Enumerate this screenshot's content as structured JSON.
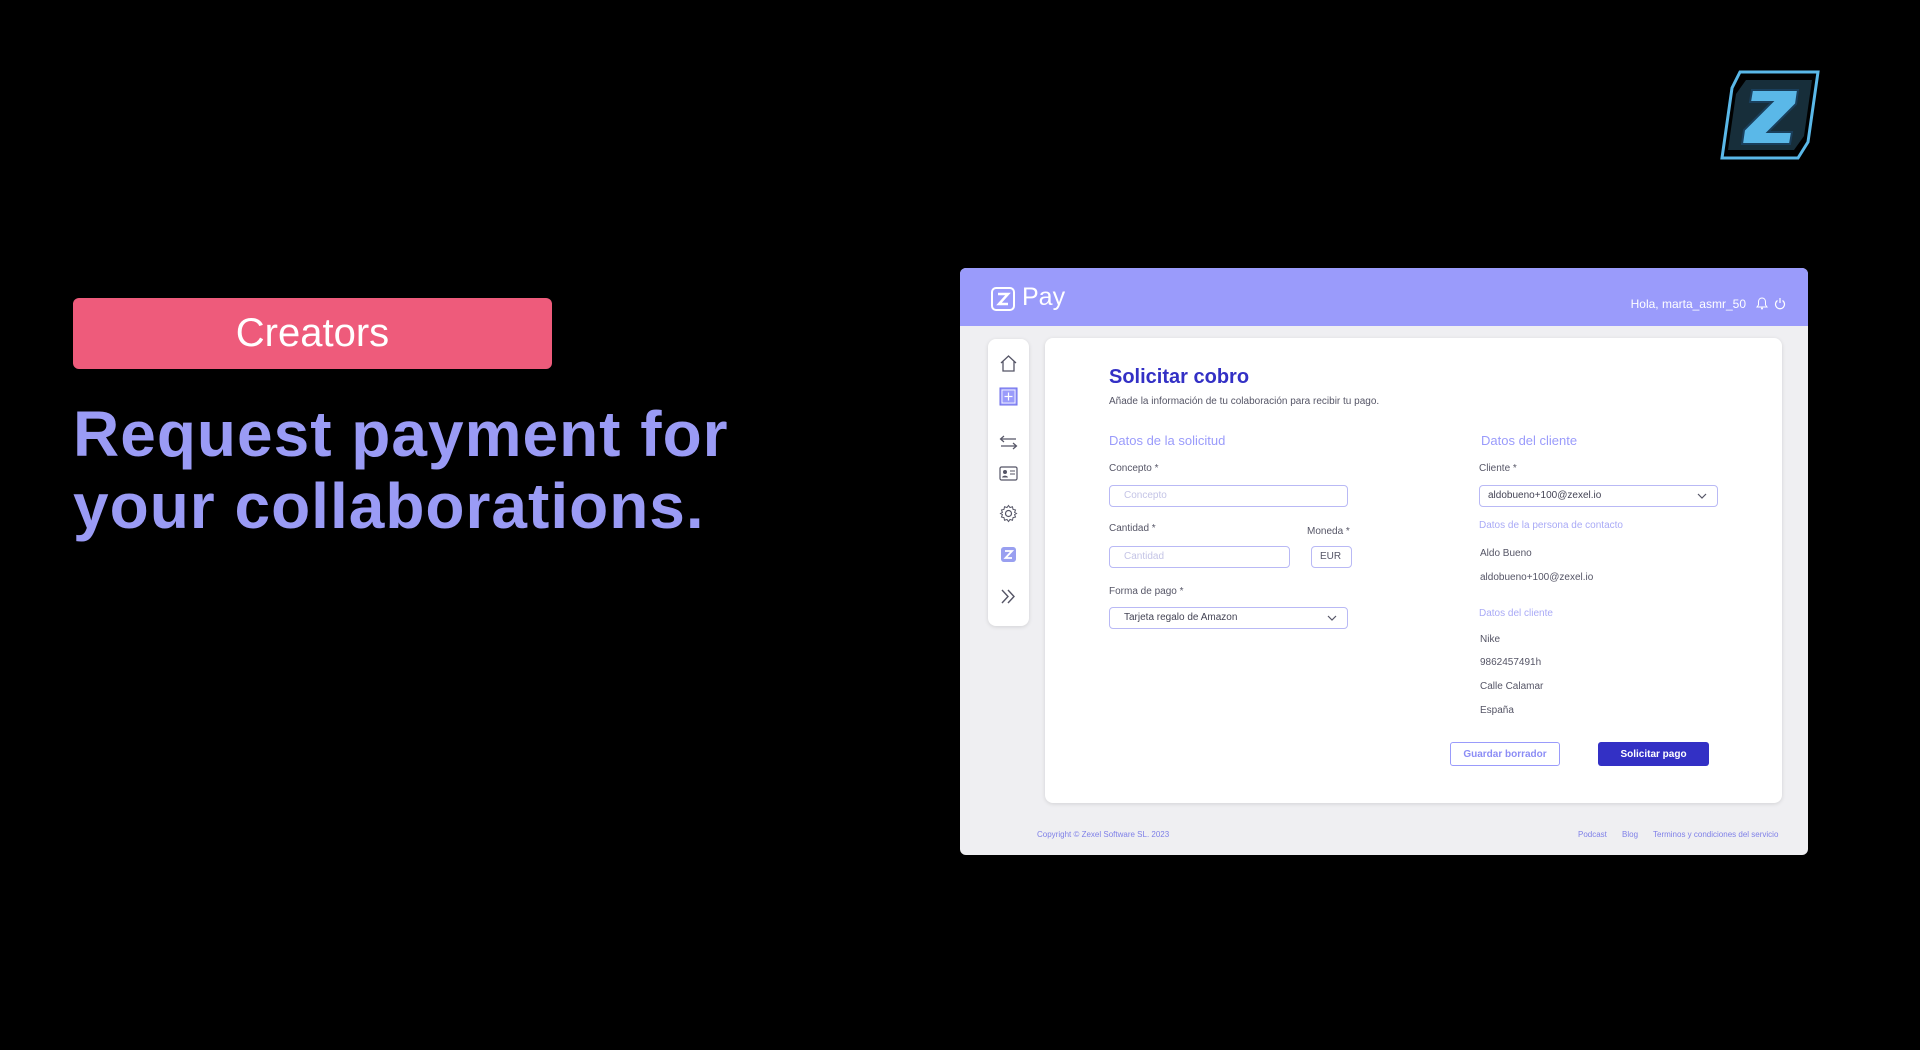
{
  "promo": {
    "badge": "Creators",
    "headline_line1": "Request payment for",
    "headline_line2": "your collaborations."
  },
  "topbar": {
    "logo_text": "Pay",
    "greeting": "Hola, marta_asmr_50"
  },
  "sidebar": {
    "items": [
      "home-icon",
      "add-request-icon",
      "transfer-icon",
      "contact-card-icon",
      "gear-icon",
      "zexel-icon",
      "expand-icon"
    ]
  },
  "form": {
    "title": "Solicitar cobro",
    "subtitle": "Añade la información de tu colaboración para recibir tu pago.",
    "request_section": "Datos de la solicitud",
    "concept_label": "Concepto *",
    "concept_placeholder": "Concepto",
    "amount_label": "Cantidad *",
    "amount_placeholder": "Cantidad",
    "currency_label": "Moneda *",
    "currency_value": "EUR",
    "payment_label": "Forma de pago *",
    "payment_value": "Tarjeta regalo de Amazon",
    "client_section": "Datos del cliente",
    "client_label": "Cliente *",
    "client_value": "aldobueno+100@zexel.io",
    "contact_section": "Datos de la persona de contacto",
    "contact_name": "Aldo Bueno",
    "contact_email": "aldobueno+100@zexel.io",
    "client_data_section": "Datos del cliente",
    "client_name": "Nike",
    "client_tax_id": "9862457491h",
    "client_address": "Calle Calamar",
    "client_country": "España",
    "save_draft": "Guardar borrador",
    "submit": "Solicitar pago"
  },
  "footer": {
    "copyright": "Copyright © Zexel Software SL. 2023",
    "links": [
      "Podcast",
      "Blog",
      "Terminos y condiciones del servicio"
    ]
  },
  "colors": {
    "accent": "#9a9bfb",
    "primary": "#3330c5",
    "badge": "#ee5b7b",
    "background": "#000000"
  }
}
